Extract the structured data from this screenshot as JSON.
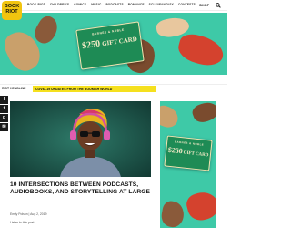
{
  "site": {
    "logo_text": "BOOK RIOT",
    "nav": [
      "BOOK RIOT",
      "CHILDREN'S",
      "COMICS",
      "MUSIC",
      "PODCASTS",
      "ROMANCE",
      "SCI FI/FANTASY",
      "CONTESTS"
    ],
    "shop_label": "SHOP",
    "search_icon": "search-icon"
  },
  "ad": {
    "brand": "BARNES & NOBLE",
    "amount": "$250",
    "card_label": "GIFT CARD",
    "background_color": "#3ec9a7"
  },
  "ticker": {
    "label": "RIOT HEADLINE",
    "headline": "COVID-19 UPDATES FROM THE BOOKISH WORLD",
    "color": "#f5e01e"
  },
  "share": [
    "f",
    "t",
    "p",
    "✉"
  ],
  "article": {
    "title": "10 INTERSECTIONS BETWEEN PODCASTS, AUDIOBOOKS, AND STORYTELLING AT LARGE",
    "byline": "Emily Polson | Aug 2, 2019",
    "body_start": "Listen to this post"
  }
}
